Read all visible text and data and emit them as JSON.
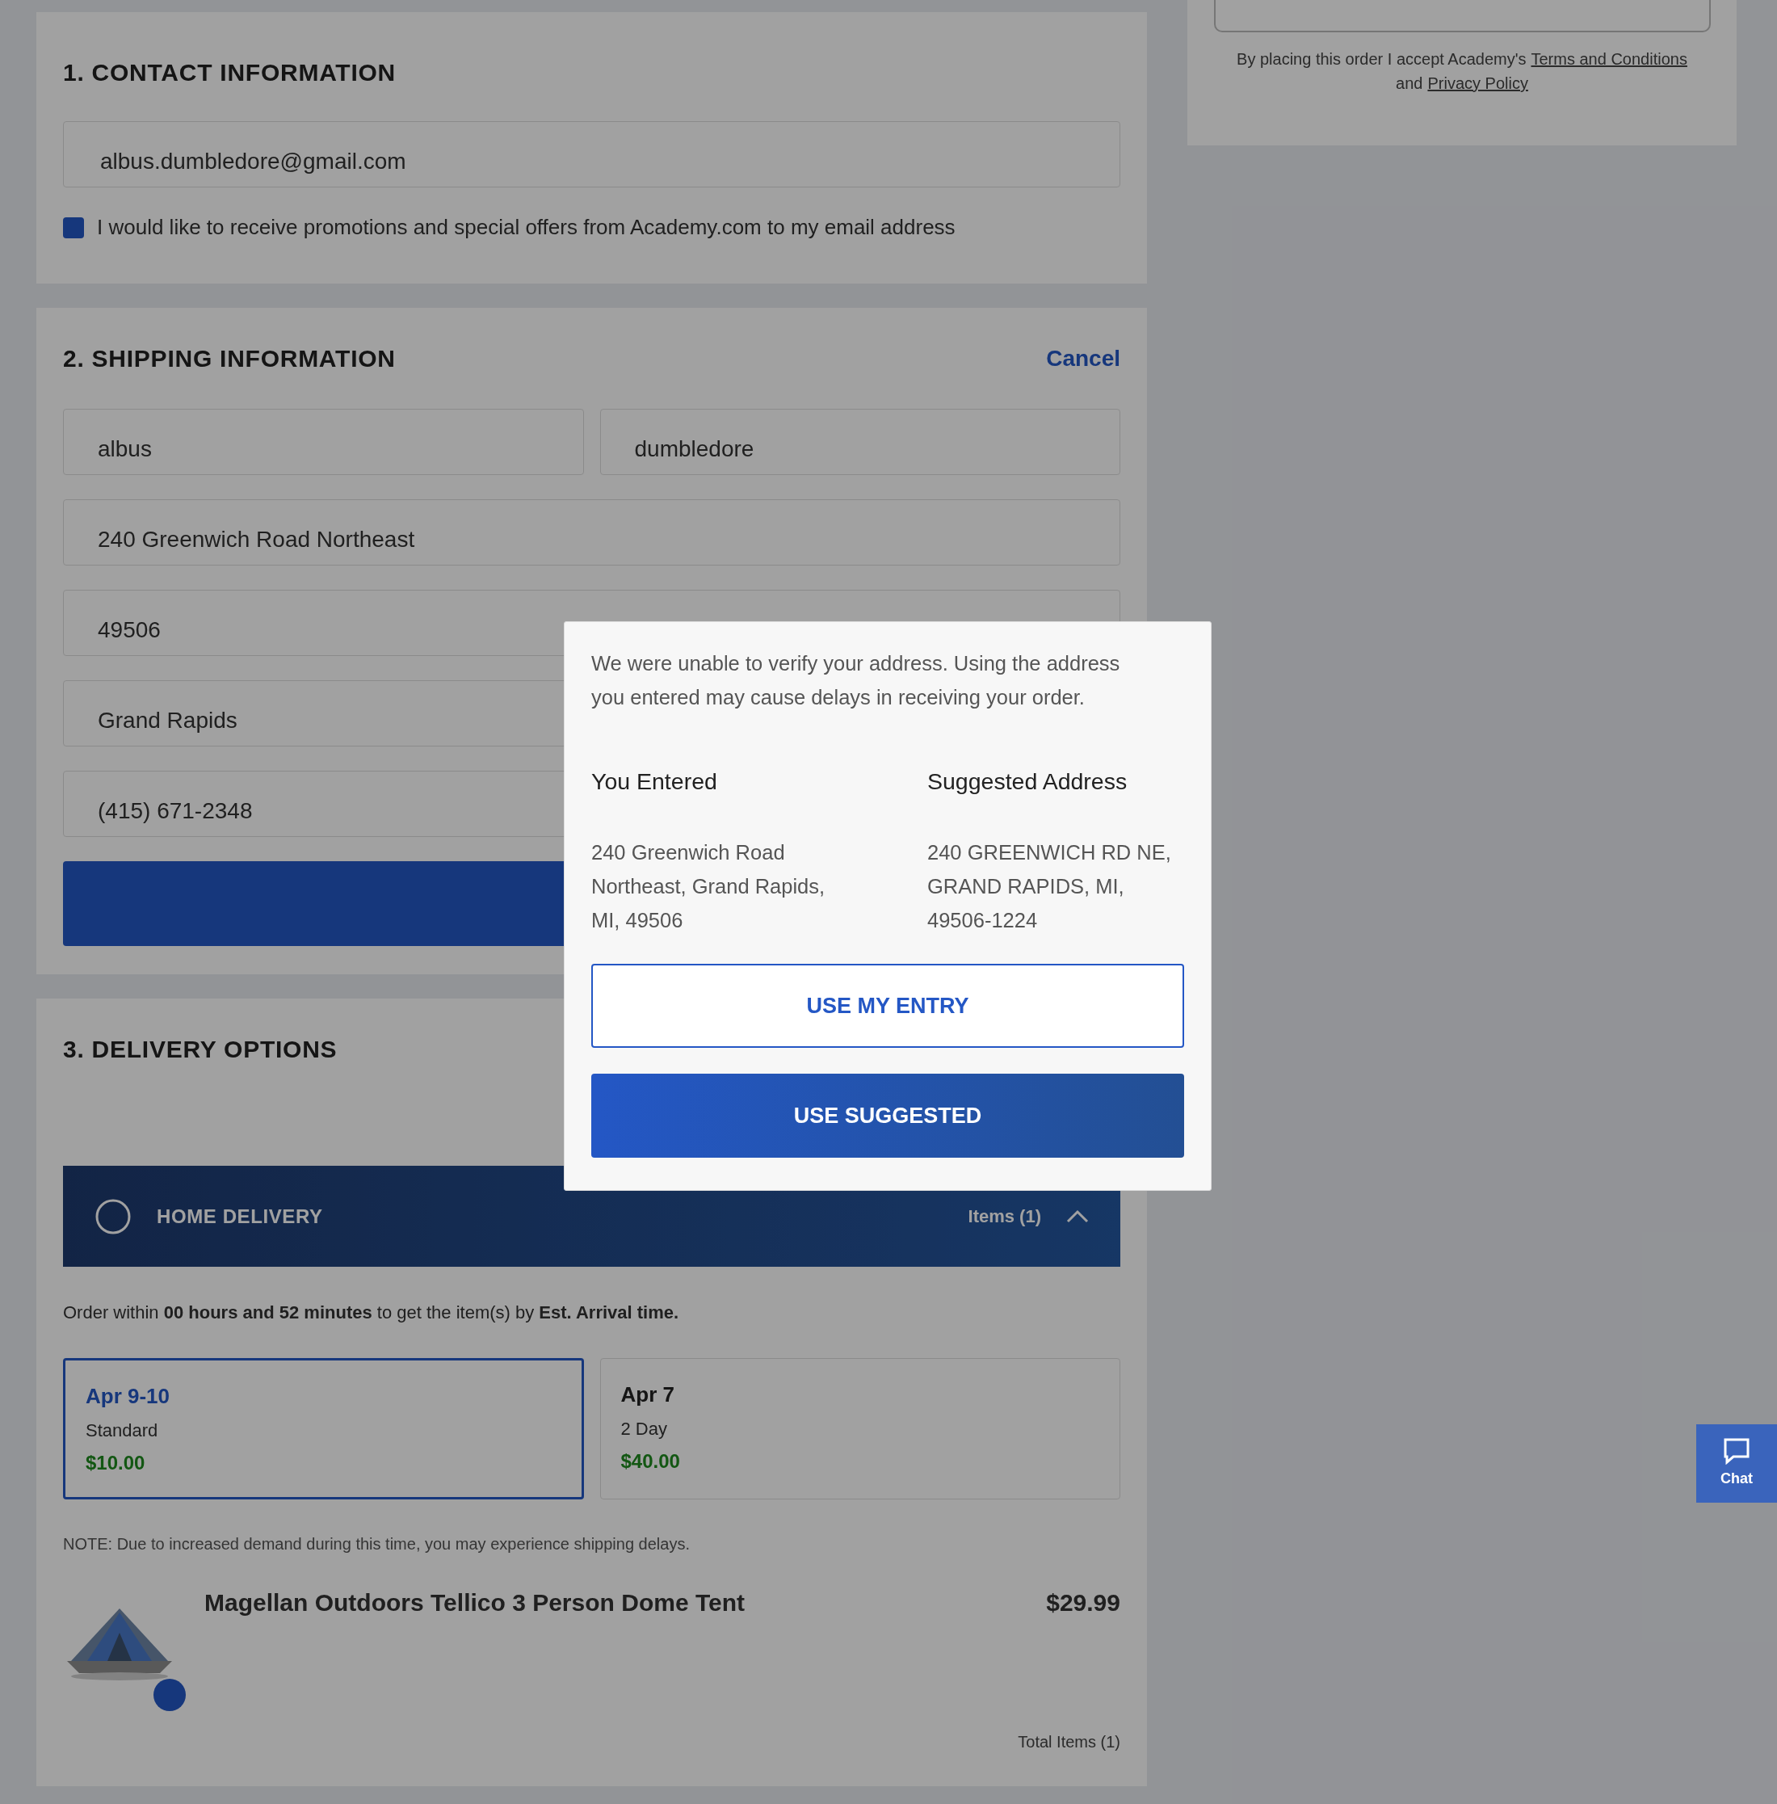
{
  "contact": {
    "title": "1. CONTACT INFORMATION",
    "email": {
      "value": "albus.dumbledore@gmail.com"
    },
    "promo": {
      "label": "I would like to receive promotions and special offers from Academy.com to my email address",
      "checked": true
    }
  },
  "shipping": {
    "title": "2. SHIPPING INFORMATION",
    "cancel": "Cancel",
    "name_fields": [
      {
        "value": "albus"
      },
      {
        "value": "dumbledore"
      }
    ],
    "fields": [
      {
        "value": "240 Greenwich Road Northeast"
      },
      {
        "value": "49506"
      },
      {
        "value": "Grand Rapids"
      },
      {
        "value": "(415) 671-2348"
      }
    ]
  },
  "delivery": {
    "title": "3. DELIVERY OPTIONS",
    "banner": {
      "label": "HOME DELIVERY",
      "items": "Items (1)"
    },
    "notice": "Order within **00 hours and 52 minutes** to get the item(s) by **Est. Arrival time.**",
    "options": [
      {
        "date": "Apr 9-10",
        "speed": "Standard",
        "price": "$10.00",
        "selected": true
      },
      {
        "date": "Apr 7",
        "speed": "2 Day",
        "price": "$40.00",
        "selected": false
      }
    ],
    "note": "NOTE: Due to increased demand during this time, you may experience shipping delays.",
    "product": {
      "name": "Magellan Outdoors Tellico 3 Person Dome Tent",
      "price": "$29.99"
    },
    "total": "Total Items (1)"
  },
  "order_panel": {
    "terms": "By placing this order I accept Academy's",
    "terms_link": "Terms and Conditions",
    "joiner": "and",
    "privacy_link": "Privacy Policy"
  },
  "chat": {
    "label": "Chat"
  },
  "dialog": {
    "message": "We were unable to verify your address. Using the address you entered may cause delays in receiving your order.",
    "columns": [
      {
        "heading": "You Entered",
        "address": "240 Greenwich Road Northeast, Grand Rapids, MI, 49506"
      },
      {
        "heading": "Suggested Address",
        "address": "240 GREENWICH RD NE, GRAND RAPIDS, MI, 49506-1224"
      }
    ],
    "buttons": [
      {
        "label": "USE MY ENTRY",
        "kind": "outline"
      },
      {
        "label": "USE SUGGESTED",
        "kind": "primary"
      }
    ]
  }
}
